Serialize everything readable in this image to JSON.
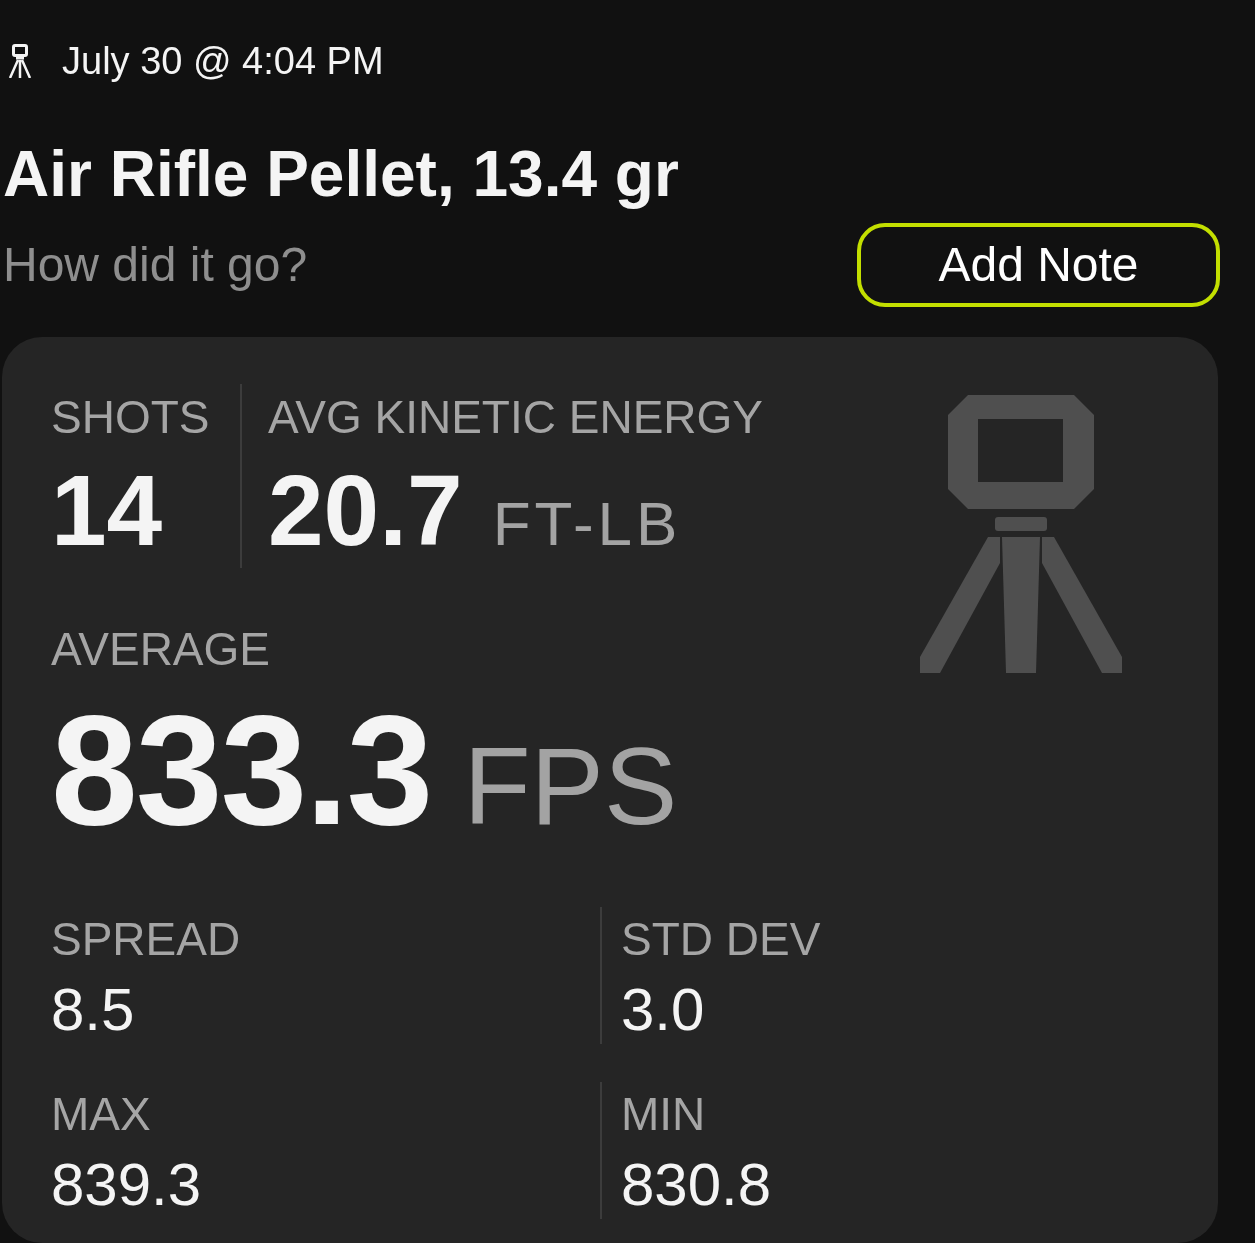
{
  "header": {
    "date": "July 30 @ 4:04 PM"
  },
  "title": "Air Rifle Pellet, 13.4 gr",
  "note": {
    "prompt": "How did it go?",
    "button": "Add Note"
  },
  "summary": {
    "shots": {
      "label": "SHOTS",
      "value": "14"
    },
    "energy": {
      "label": "AVG KINETIC ENERGY",
      "value": "20.7",
      "unit": "FT-LB"
    },
    "average": {
      "label": "AVERAGE",
      "value": "833.3",
      "unit": "FPS"
    },
    "stats": [
      {
        "label": "SPREAD",
        "value": "8.5"
      },
      {
        "label": "STD DEV",
        "value": "3.0"
      },
      {
        "label": "MAX",
        "value": "839.3"
      },
      {
        "label": "MIN",
        "value": "830.8"
      }
    ]
  }
}
